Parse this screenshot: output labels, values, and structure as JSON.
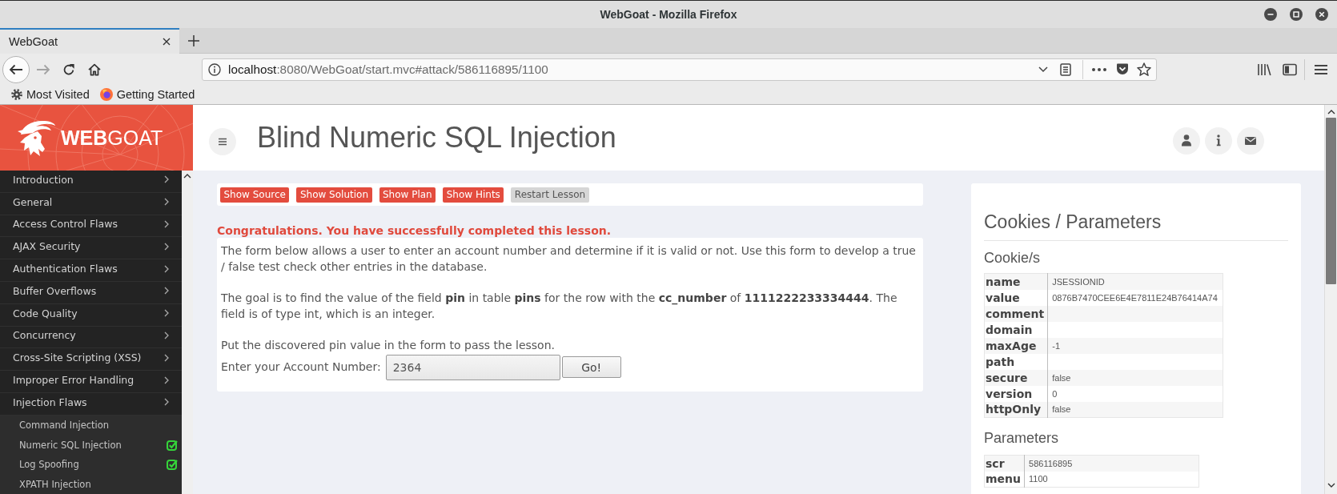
{
  "window": {
    "title": "WebGoat - Mozilla Firefox"
  },
  "tabs": [
    {
      "label": "WebGoat",
      "selected": true
    }
  ],
  "navigation": {
    "forward_disabled": true,
    "url_host": "localhost",
    "url_rest": ":8080/WebGoat/start.mvc#attack/586116895/1100"
  },
  "bookmarks": [
    {
      "label": "Most Visited",
      "kind": "folder"
    },
    {
      "label": "Getting Started",
      "kind": "page"
    }
  ],
  "sidebar": {
    "logo": "**WEB**GOAT",
    "items": [
      {
        "label": "Introduction"
      },
      {
        "label": "General"
      },
      {
        "label": "Access Control Flaws"
      },
      {
        "label": "AJAX Security"
      },
      {
        "label": "Authentication Flaws"
      },
      {
        "label": "Buffer Overflows"
      },
      {
        "label": "Code Quality"
      },
      {
        "label": "Concurrency"
      },
      {
        "label": "Cross-Site Scripting (XSS)"
      },
      {
        "label": "Improper Error Handling"
      },
      {
        "label": "Injection Flaws",
        "children": [
          {
            "label": "Command Injection",
            "completed": false
          },
          {
            "label": "Numeric SQL Injection",
            "completed": true
          },
          {
            "label": "Log Spoofing",
            "completed": true
          },
          {
            "label": "XPATH Injection",
            "completed": false
          }
        ]
      }
    ]
  },
  "header": {
    "title": "Blind Numeric SQL Injection"
  },
  "lesson_buttons": [
    {
      "label": "Show Source",
      "kind": "help"
    },
    {
      "label": "Show Solution",
      "kind": "help"
    },
    {
      "label": "Show Plan",
      "kind": "help"
    },
    {
      "label": "Show Hints",
      "kind": "help"
    },
    {
      "label": "Restart Lesson",
      "kind": "restart"
    }
  ],
  "lesson": {
    "message": "Congratulations. You have successfully completed this lesson.",
    "paragraphs": [
      "The form below allows a user to enter an account number and determine if it is valid or not. Use this form to develop a true / false test check other entries in the database.",
      "The goal is to find the value of the field **pin** in table **pins** for the row with the **cc_number** of **1111222233334444**. The field is of type int, which is an integer.",
      "Put the discovered pin value in the form to pass the lesson."
    ],
    "form": {
      "label": "Enter your Account Number:",
      "value": "2364",
      "button": "Go!"
    }
  },
  "cookies_panel": {
    "title": "Cookies / Parameters",
    "cookies_heading": "Cookie/s",
    "cookies": [
      {
        "name": "name",
        "value": "JSESSIONID"
      },
      {
        "name": "value",
        "value": "0876B7470CEE6E4E7811E24B76414A74"
      },
      {
        "name": "comment"
      },
      {
        "name": "domain"
      },
      {
        "name": "maxAge",
        "value": "-1"
      },
      {
        "name": "path"
      },
      {
        "name": "secure",
        "value": "false"
      },
      {
        "name": "version",
        "value": "0"
      },
      {
        "name": "httpOnly",
        "value": "false"
      }
    ],
    "parameters_heading": "Parameters",
    "parameters": [
      {
        "name": "scr",
        "value": "586116895"
      },
      {
        "name": "menu",
        "value": "1100"
      }
    ]
  }
}
